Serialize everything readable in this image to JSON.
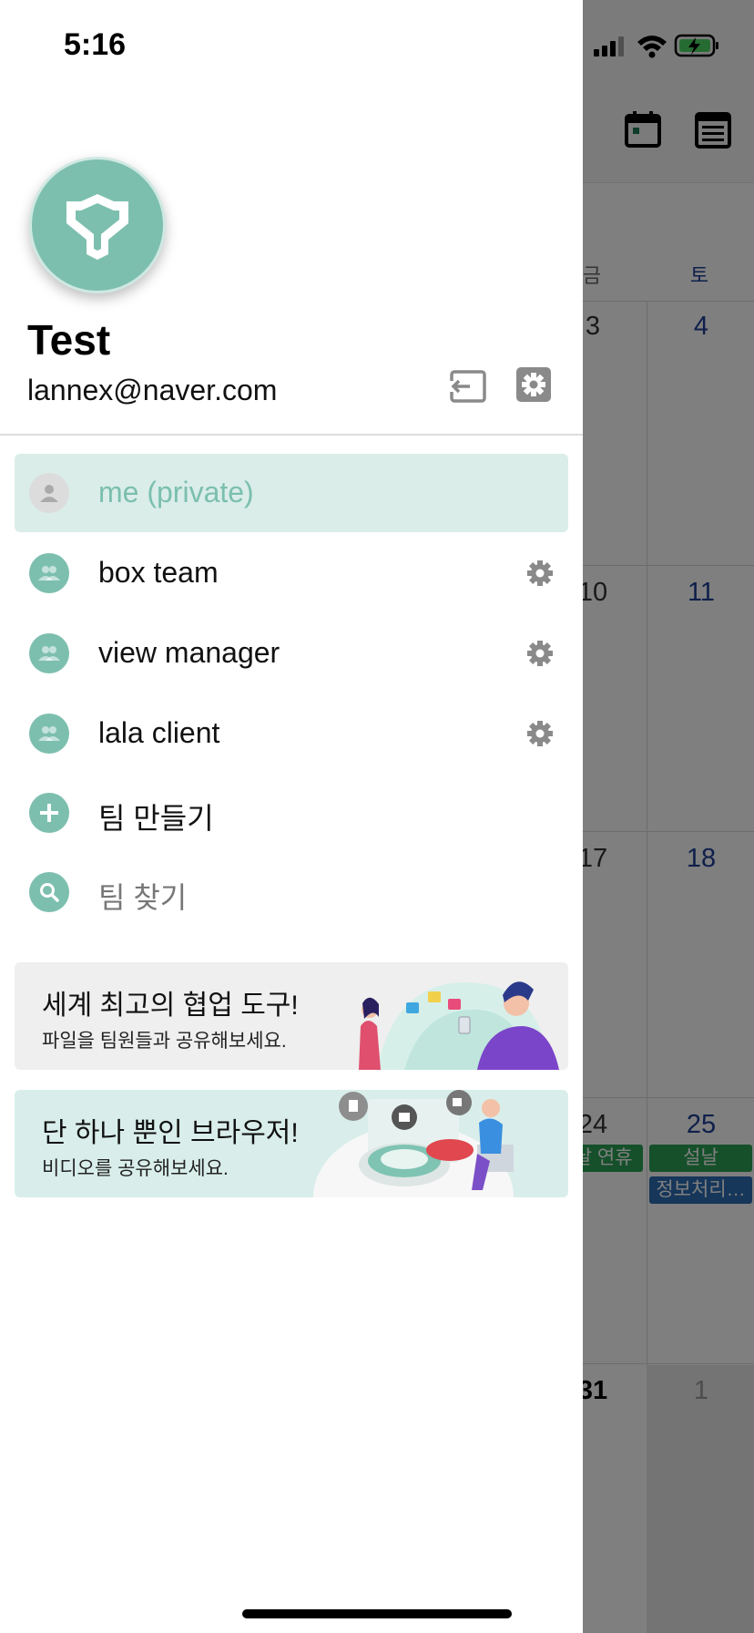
{
  "status_bar": {
    "time": "5:16"
  },
  "calendar_background": {
    "weekday_fri": "금",
    "weekday_sat": "토",
    "weeks": [
      {
        "fri": "3",
        "sat": "4"
      },
      {
        "fri": "10",
        "sat": "11"
      },
      {
        "fri": "17",
        "sat": "18"
      },
      {
        "fri": "24",
        "sat": "25"
      },
      {
        "fri": "31",
        "sat": "1"
      }
    ],
    "events": {
      "fri_24": "설날 연휴",
      "sat_25_1": "설날",
      "sat_25_2": "정보처리…"
    },
    "colors": {
      "holiday": "#2aa054",
      "event": "#2c6db5"
    }
  },
  "profile": {
    "name": "Test",
    "email": "lannex@naver.com"
  },
  "teams": [
    {
      "label": "me (private)",
      "selected": true
    },
    {
      "label": "box team"
    },
    {
      "label": "view manager"
    },
    {
      "label": "lala client"
    }
  ],
  "actions": {
    "create_team": "팀 만들기",
    "find_team": "팀 찾기"
  },
  "banners": [
    {
      "title": "세계 최고의 협업 도구!",
      "subtitle": "파일을 팀원들과 공유해보세요."
    },
    {
      "title": "단 하나 뿐인 브라우저!",
      "subtitle": "비디오를 공유해보세요."
    }
  ],
  "icons": {
    "logout": "logout-icon",
    "settings": "gear-icon",
    "calendar_month": "calendar-icon",
    "list_view": "list-icon"
  },
  "colors": {
    "accent": "#7dbfaf",
    "selected_bg": "#daede9"
  }
}
